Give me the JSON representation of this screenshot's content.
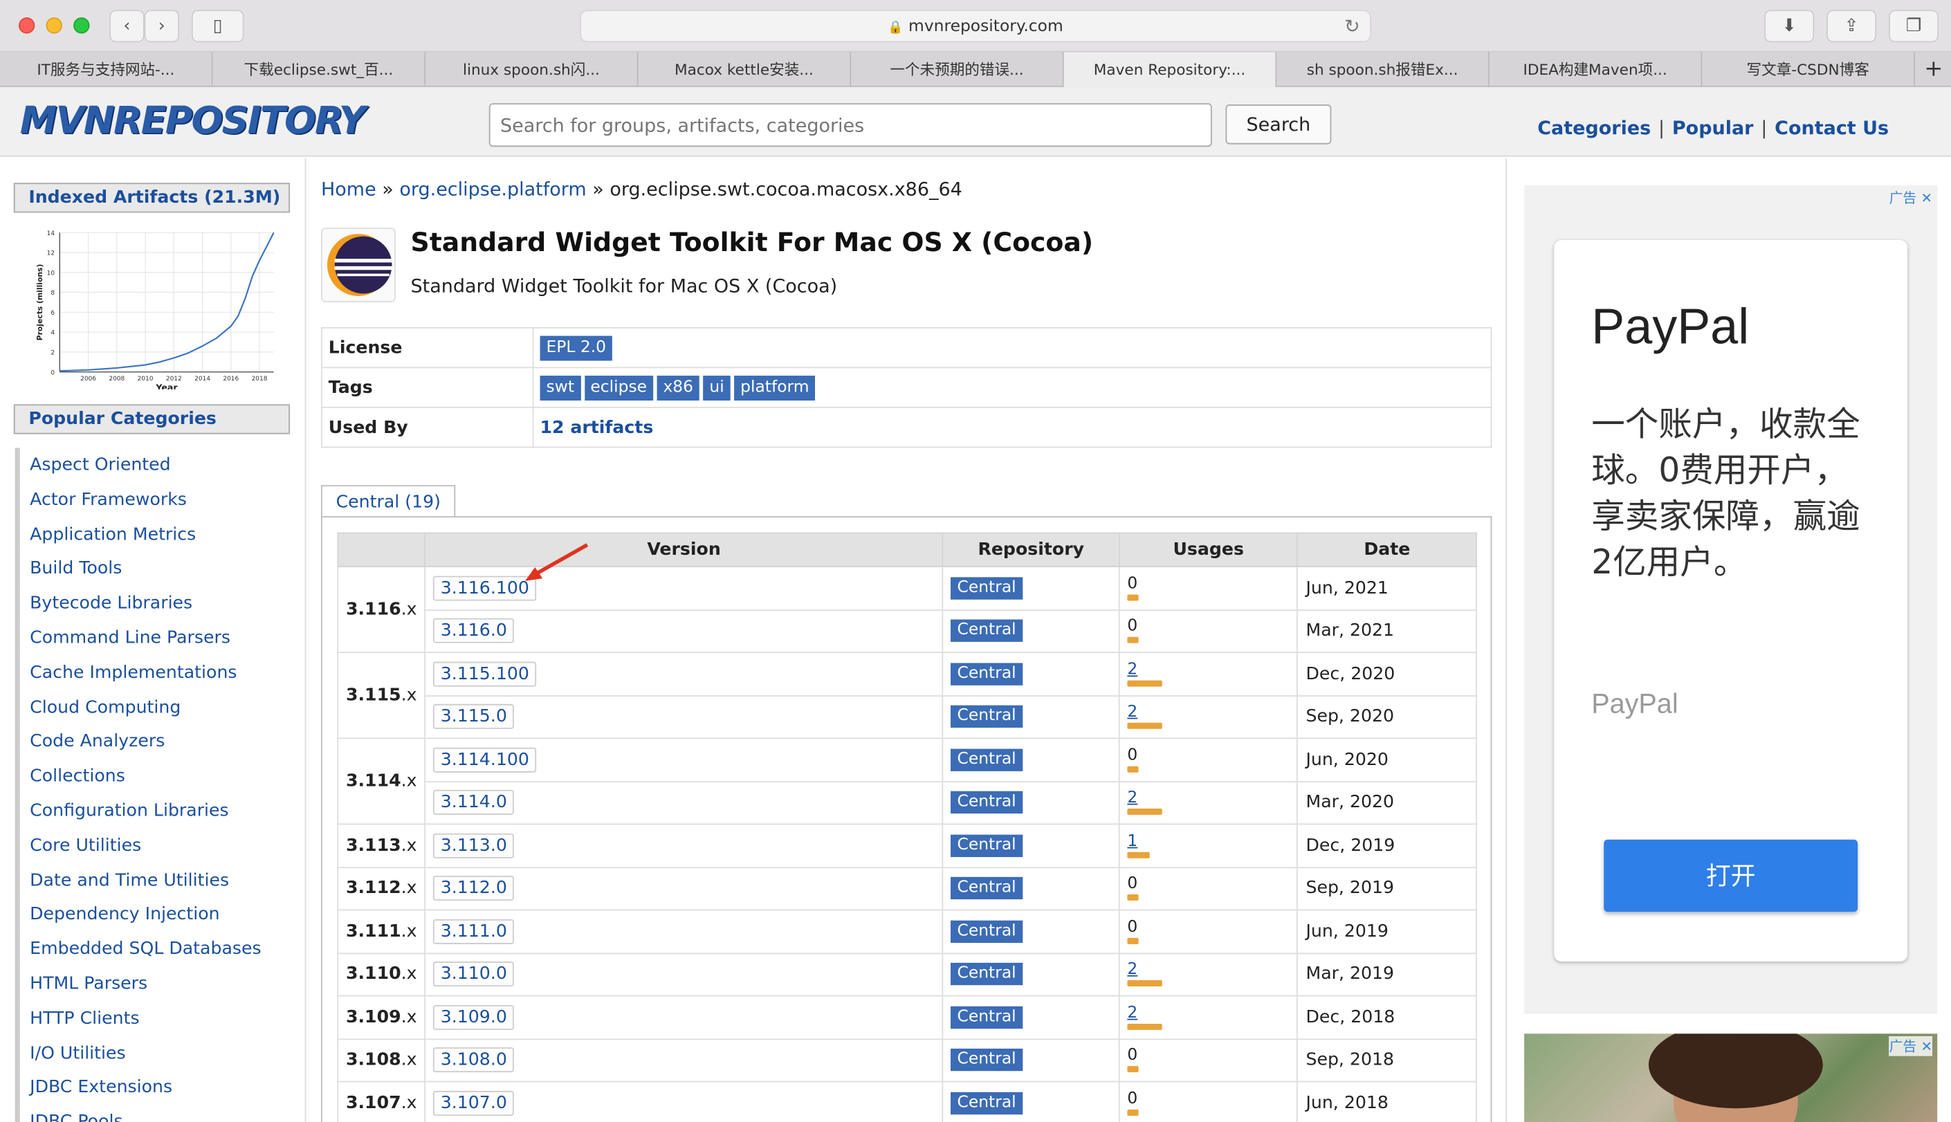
{
  "browser": {
    "url": "mvnrepository.com",
    "tabs": [
      "IT服务与支持网站-...",
      "下载eclipse.swt_百...",
      "linux spoon.sh闪...",
      "Macox kettle安装...",
      "一个未预期的错误...",
      "Maven Repository:...",
      "sh spoon.sh报错Ex...",
      "IDEA构建Maven项...",
      "写文章-CSDN博客"
    ],
    "active_tab_index": 5
  },
  "header": {
    "logo": "MVNREPOSITORY",
    "search_placeholder": "Search for groups, artifacts, categories",
    "search_button": "Search",
    "links": [
      "Categories",
      "Popular",
      "Contact Us"
    ]
  },
  "sidebar": {
    "indexed_title": "Indexed Artifacts (21.3M)",
    "chart_data": {
      "type": "line",
      "xlabel": "Year",
      "ylabel": "Projects (millions)",
      "y_ticks": [
        "0",
        "2",
        "4",
        "6",
        "8",
        "10",
        "12",
        "14"
      ],
      "x_ticks": [
        "2006",
        "2008",
        "2010",
        "2012",
        "2014",
        "2016",
        "2018"
      ],
      "ylim": [
        0,
        14
      ],
      "x": [
        2004,
        2006,
        2008,
        2010,
        2011,
        2012,
        2013,
        2014,
        2015,
        2016,
        2016.5,
        2017,
        2017.5,
        2018,
        2018.5,
        2019
      ],
      "values": [
        0.1,
        0.2,
        0.4,
        0.7,
        1.0,
        1.4,
        1.9,
        2.6,
        3.4,
        4.6,
        5.6,
        7.4,
        9.6,
        11.2,
        12.6,
        14
      ]
    },
    "categories_title": "Popular Categories",
    "categories": [
      "Aspect Oriented",
      "Actor Frameworks",
      "Application Metrics",
      "Build Tools",
      "Bytecode Libraries",
      "Command Line Parsers",
      "Cache Implementations",
      "Cloud Computing",
      "Code Analyzers",
      "Collections",
      "Configuration Libraries",
      "Core Utilities",
      "Date and Time Utilities",
      "Dependency Injection",
      "Embedded SQL Databases",
      "HTML Parsers",
      "HTTP Clients",
      "I/O Utilities",
      "JDBC Extensions",
      "JDBC Pools"
    ]
  },
  "main": {
    "breadcrumb": {
      "home": "Home",
      "group": "org.eclipse.platform",
      "artifact": "org.eclipse.swt.cocoa.macosx.x86_64",
      "sep": "»"
    },
    "title": "Standard Widget Toolkit For Mac OS X (Cocoa)",
    "subtitle": "Standard Widget Toolkit for Mac OS X (Cocoa)",
    "info": {
      "license_label": "License",
      "license": "EPL 2.0",
      "tags_label": "Tags",
      "tags": [
        "swt",
        "eclipse",
        "x86",
        "ui",
        "platform"
      ],
      "usedby_label": "Used By",
      "usedby": "12 artifacts"
    },
    "tab": "Central (19)",
    "columns": [
      "Version",
      "Repository",
      "Usages",
      "Date"
    ],
    "rows": [
      {
        "group": "3.116",
        "version": "3.116.100",
        "repo": "Central",
        "usages": 0,
        "date": "Jun, 2021"
      },
      {
        "group": "",
        "version": "3.116.0",
        "repo": "Central",
        "usages": 0,
        "date": "Mar, 2021"
      },
      {
        "group": "3.115",
        "version": "3.115.100",
        "repo": "Central",
        "usages": 2,
        "date": "Dec, 2020"
      },
      {
        "group": "",
        "version": "3.115.0",
        "repo": "Central",
        "usages": 2,
        "date": "Sep, 2020"
      },
      {
        "group": "3.114",
        "version": "3.114.100",
        "repo": "Central",
        "usages": 0,
        "date": "Jun, 2020"
      },
      {
        "group": "",
        "version": "3.114.0",
        "repo": "Central",
        "usages": 2,
        "date": "Mar, 2020"
      },
      {
        "group": "3.113",
        "version": "3.113.0",
        "repo": "Central",
        "usages": 1,
        "date": "Dec, 2019"
      },
      {
        "group": "3.112",
        "version": "3.112.0",
        "repo": "Central",
        "usages": 0,
        "date": "Sep, 2019"
      },
      {
        "group": "3.111",
        "version": "3.111.0",
        "repo": "Central",
        "usages": 0,
        "date": "Jun, 2019"
      },
      {
        "group": "3.110",
        "version": "3.110.0",
        "repo": "Central",
        "usages": 2,
        "date": "Mar, 2019"
      },
      {
        "group": "3.109",
        "version": "3.109.0",
        "repo": "Central",
        "usages": 2,
        "date": "Dec, 2018"
      },
      {
        "group": "3.108",
        "version": "3.108.0",
        "repo": "Central",
        "usages": 0,
        "date": "Sep, 2018"
      },
      {
        "group": "3.107",
        "version": "3.107.0",
        "repo": "Central",
        "usages": 0,
        "date": "Jun, 2018"
      }
    ],
    "group_suffix": ".x"
  },
  "ad": {
    "close_label": "广告",
    "brand": "PayPal",
    "text": "一个账户，收款全球。0费用开户，享卖家保障，赢逾2亿用户。",
    "brand_small": "PayPal",
    "button": "打开"
  },
  "colors": {
    "link": "#1a4f9c",
    "badge": "#3b6cb5",
    "usage_bar": "#e8a33a",
    "ad_button": "#2f7fe8"
  }
}
